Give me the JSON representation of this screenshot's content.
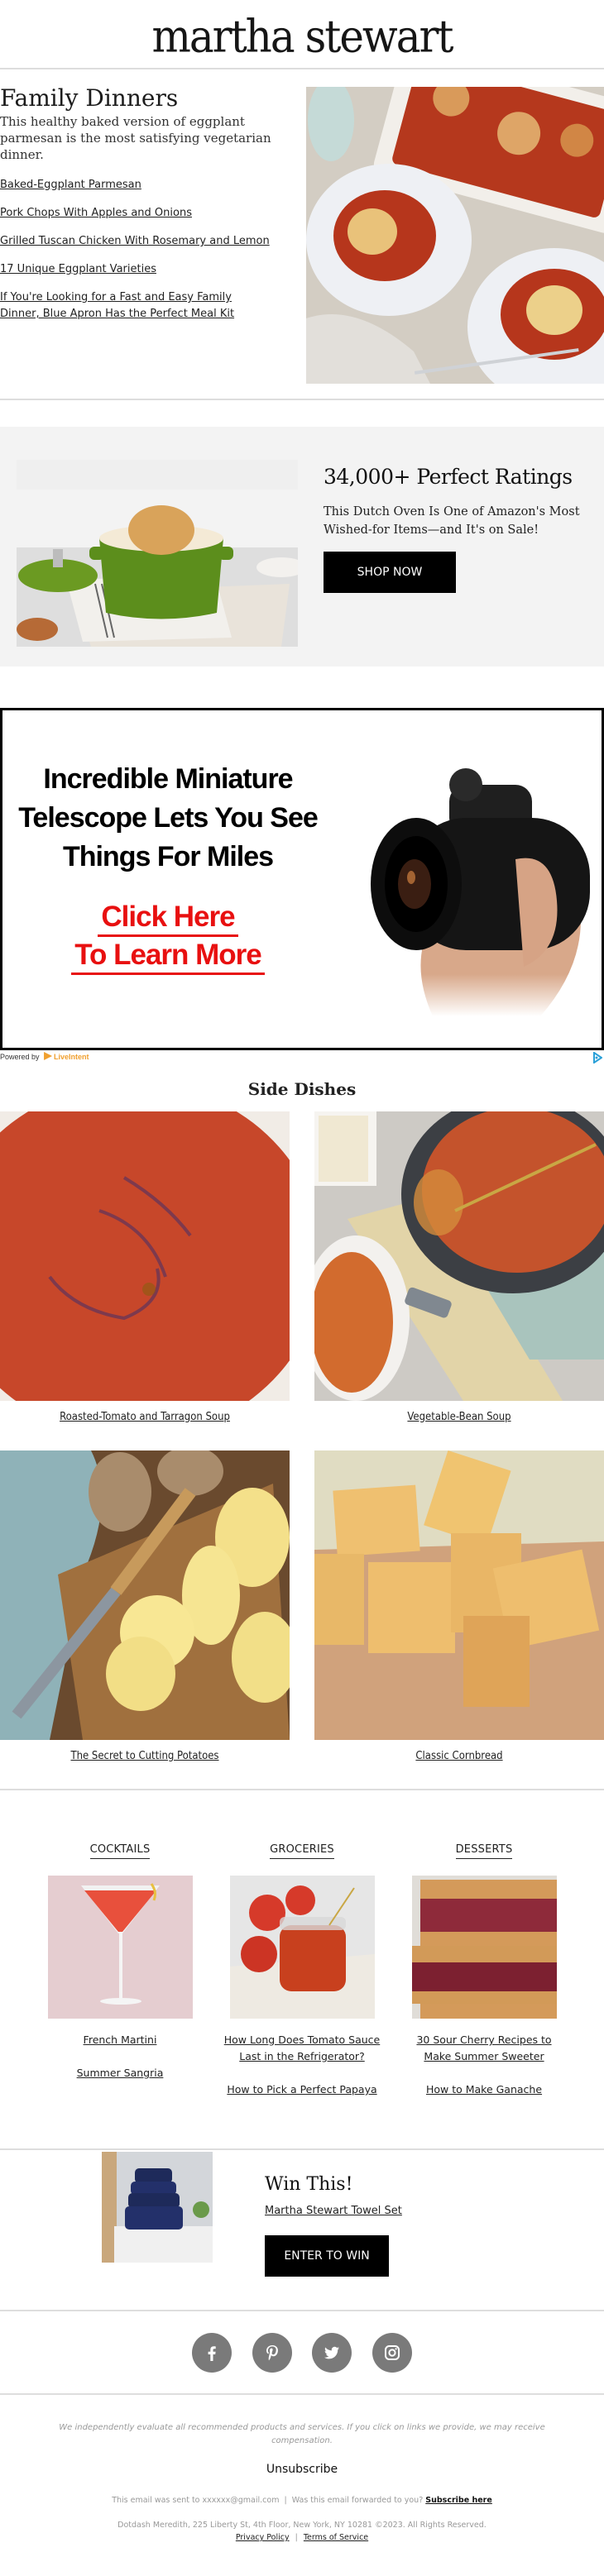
{
  "header": {
    "brand": "martha stewart"
  },
  "family_dinners": {
    "title": "Family Dinners",
    "description": "This healthy baked version of eggplant parmesan is the most satisfying vegetarian dinner.",
    "links": [
      "Baked-Eggplant Parmesan",
      "Pork Chops With Apples and Onions",
      "Grilled Tuscan Chicken With Rosemary and Lemon",
      "17 Unique Eggplant Varieties",
      "If You're Looking for a Fast and Easy Family Dinner, Blue Apron Has the Perfect Meal Kit"
    ],
    "image_alt": "Baked eggplant parmesan on plates"
  },
  "promo": {
    "title": "34,000+ Perfect Ratings",
    "subtitle": "This Dutch Oven Is One of Amazon's Most Wished-for Items—and It's on Sale!",
    "button": "SHOP NOW",
    "image_alt": "Green Dutch oven with roasted cauliflower"
  },
  "ad": {
    "headline": "Incredible Miniature Telescope Lets You See Things For Miles",
    "cta_line1": "Click Here",
    "cta_line2": "To Learn More",
    "powered_by": "Powered by",
    "provider": "LiveIntent",
    "cta_color": "#e81010"
  },
  "side_dishes": {
    "title": "Side Dishes",
    "items": [
      {
        "caption": "Roasted-Tomato and Tarragon Soup"
      },
      {
        "caption": "Vegetable-Bean Soup"
      },
      {
        "caption": "The Secret to Cutting Potatoes"
      },
      {
        "caption": "Classic Cornbread"
      }
    ]
  },
  "categories": [
    {
      "heading": "COCKTAILS",
      "links": [
        "French Martini",
        "Summer Sangria"
      ]
    },
    {
      "heading": "GROCERIES",
      "links": [
        "How Long Does Tomato Sauce Last in the Refrigerator?",
        "How to Pick a Perfect Papaya"
      ]
    },
    {
      "heading": "DESSERTS",
      "links": [
        "30 Sour Cherry Recipes to Make Summer Sweeter",
        "How to Make Ganache"
      ]
    }
  ],
  "win": {
    "title": "Win This!",
    "link": "Martha Stewart Towel Set",
    "button": "ENTER TO WIN"
  },
  "social": [
    "facebook",
    "pinterest",
    "twitter",
    "instagram"
  ],
  "footer": {
    "disclaimer": "We independently evaluate all recommended products and services. If you click on links we provide, we may receive compensation.",
    "unsubscribe": "Unsubscribe",
    "sent_to": "This email was sent to xxxxxx@gmail.com  |  Was this email forwarded to you?",
    "subscribe_here": "Subscribe here",
    "address": "Dotdash Meredith, 225 Liberty St, 4th Floor, New York, NY 10281 ©2023. All Rights Reserved.",
    "privacy": "Privacy Policy",
    "separator": "|",
    "terms": "Terms of Service"
  }
}
